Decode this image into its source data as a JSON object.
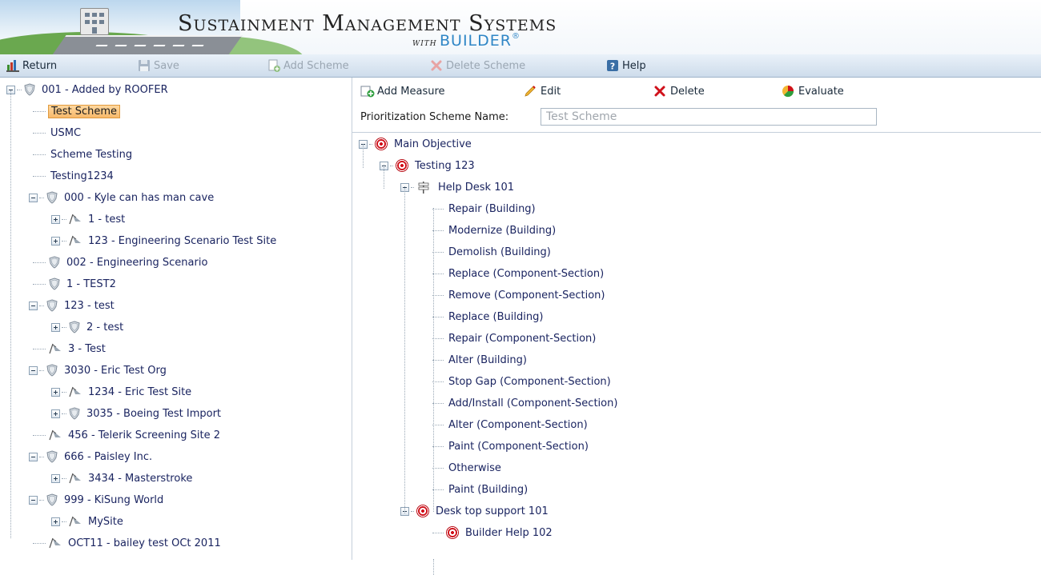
{
  "app": {
    "title": "Sustainment Management Systems",
    "with": "WITH",
    "builder": "BUILDER",
    "registered": "®"
  },
  "toolbar": {
    "return_label": "Return",
    "save_label": "Save",
    "add_scheme_label": "Add Scheme",
    "delete_scheme_label": "Delete Scheme",
    "help_label": "Help"
  },
  "left_tree": [
    {
      "label": "001 - Added by ROOFER",
      "icon": "shield-icon",
      "expander": "minus",
      "selected": false
    },
    {
      "label": "Test Scheme",
      "icon": "",
      "expander": "",
      "selected": true
    },
    {
      "label": "USMC",
      "icon": "",
      "expander": "",
      "selected": false
    },
    {
      "label": "Scheme Testing",
      "icon": "",
      "expander": "",
      "selected": false
    },
    {
      "label": "Testing1234",
      "icon": "",
      "expander": "",
      "selected": false
    },
    {
      "label": "000 - Kyle can has man cave",
      "icon": "shield-icon",
      "expander": "minus",
      "selected": false
    },
    {
      "label": "1 - test",
      "icon": "flag-icon",
      "expander": "plus",
      "selected": false
    },
    {
      "label": "123 - Engineering Scenario Test Site",
      "icon": "flag-icon",
      "expander": "plus",
      "selected": false
    },
    {
      "label": "002 - Engineering Scenario",
      "icon": "shield-icon",
      "expander": "",
      "selected": false
    },
    {
      "label": "1 - TEST2",
      "icon": "shield-icon",
      "expander": "",
      "selected": false
    },
    {
      "label": "123 - test",
      "icon": "shield-icon",
      "expander": "minus",
      "selected": false
    },
    {
      "label": "2 - test",
      "icon": "shield-icon",
      "expander": "plus",
      "selected": false
    },
    {
      "label": "3 - Test",
      "icon": "flag-icon",
      "expander": "",
      "selected": false
    },
    {
      "label": "3030 - Eric Test Org",
      "icon": "shield-icon",
      "expander": "minus",
      "selected": false
    },
    {
      "label": "1234 - Eric Test Site",
      "icon": "flag-icon",
      "expander": "plus",
      "selected": false
    },
    {
      "label": "3035 - Boeing Test Import",
      "icon": "shield-icon",
      "expander": "plus",
      "selected": false
    },
    {
      "label": "456 - Telerik Screening Site 2",
      "icon": "flag-icon",
      "expander": "",
      "selected": false
    },
    {
      "label": "666 - Paisley Inc.",
      "icon": "shield-icon",
      "expander": "minus",
      "selected": false
    },
    {
      "label": "3434 - Masterstroke",
      "icon": "flag-icon",
      "expander": "plus",
      "selected": false
    },
    {
      "label": "999 - KiSung World",
      "icon": "shield-icon",
      "expander": "minus",
      "selected": false
    },
    {
      "label": "MySite",
      "icon": "flag-icon",
      "expander": "plus",
      "selected": false
    },
    {
      "label": "OCT11 - bailey test OCt 2011",
      "icon": "flag-icon",
      "expander": "",
      "selected": false
    }
  ],
  "right_toolbar": {
    "add_measure_label": "Add Measure",
    "edit_label": "Edit",
    "delete_label": "Delete",
    "evaluate_label": "Evaluate"
  },
  "scheme": {
    "label": "Prioritization Scheme Name:",
    "value": "Test Scheme"
  },
  "right_tree": {
    "root": "Main Objective",
    "child": "Testing 123",
    "group": "Help Desk 101",
    "items": [
      "Repair (Building)",
      "Modernize (Building)",
      "Demolish (Building)",
      "Replace (Component-Section)",
      "Remove (Component-Section)",
      "Replace (Building)",
      "Repair (Component-Section)",
      "Alter (Building)",
      "Stop Gap (Component-Section)",
      "Add/Install (Component-Section)",
      "Alter (Component-Section)",
      "Paint (Component-Section)",
      "Otherwise",
      "Paint (Building)"
    ],
    "second_child": "Desk top support 101",
    "grandchild": "Builder Help 102"
  },
  "colors": {
    "toolbar_top": "#e9f1f9",
    "toolbar_bottom": "#cedceb",
    "selection": "#f7b96a",
    "tree_text": "#1a2460",
    "target_red": "#d0111b",
    "builder_blue": "#2f86c6"
  }
}
